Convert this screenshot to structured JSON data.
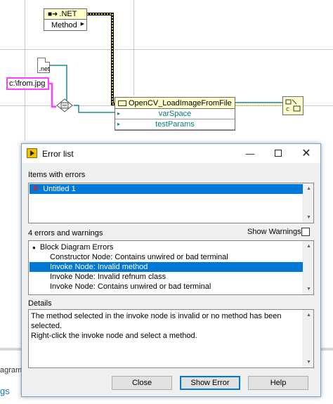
{
  "diagram": {
    "net_node": {
      "title": ".NET",
      "method_label": "Method"
    },
    "file_ext_label": ".net",
    "path_constant": "c:\\from.jpg",
    "invoke_node": {
      "title": "OpenCV_LoadImageFromFile",
      "params": [
        "varSpace",
        "testParams"
      ]
    },
    "status_text": "agram",
    "status_link": "gs"
  },
  "dialog": {
    "title": "Error list",
    "items_label": "Items with errors",
    "items": [
      {
        "label": "Untitled 1",
        "selected": true
      }
    ],
    "errors_count_label": "4 errors and warnings",
    "show_warnings_label": "Show Warnings",
    "show_warnings_checked": false,
    "error_tree": [
      {
        "label": "Block Diagram Errors",
        "level": 0,
        "selected": false
      },
      {
        "label": "Constructor Node: Contains unwired or bad terminal",
        "level": 1,
        "selected": false
      },
      {
        "label": "Invoke Node: Invalid method",
        "level": 1,
        "selected": true
      },
      {
        "label": "Invoke Node: Invalid refnum class",
        "level": 1,
        "selected": false
      },
      {
        "label": "Invoke Node: Contains unwired or bad terminal",
        "level": 1,
        "selected": false
      }
    ],
    "details_label": "Details",
    "details_text": "The method selected in the invoke node is invalid or no method has been selected.\nRight-click the invoke node and select a method.",
    "buttons": {
      "close": "Close",
      "show_error": "Show Error",
      "help": "Help"
    }
  },
  "colors": {
    "selection": "#0078d7",
    "wire_refnum": "#1a8c8c",
    "wire_path": "#ff40ff",
    "wire_class": "#c8b400"
  }
}
